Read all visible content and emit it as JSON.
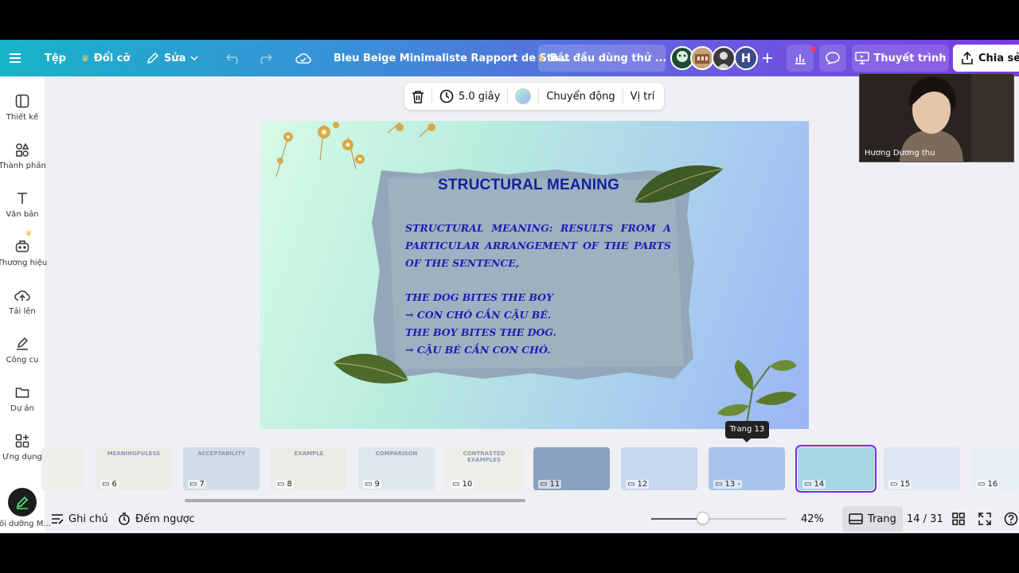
{
  "colors": {
    "accent": "#7d2ae8",
    "slide_text": "#1c1cb4",
    "slide_heading": "#12229a"
  },
  "topbar": {
    "menu_icon": "hamburger-icon",
    "file_label": "Tệp",
    "resize_label": "Đổi cỡ",
    "edit_label": "Sửa",
    "document_title": "Bleu Beige Minimaliste Rapport de Sta...",
    "trial_label": "Bắt đầu dùng thử ...",
    "avatar_initial": "H",
    "present_label": "Thuyết trình",
    "share_label": "Chia sẻ"
  },
  "sidebar": {
    "items": [
      {
        "label": "Thiết kế",
        "icon": "layout-icon"
      },
      {
        "label": "Thành phần",
        "icon": "elements-icon"
      },
      {
        "label": "Văn bản",
        "icon": "text-icon"
      },
      {
        "label": "Thương hiệu",
        "icon": "brand-icon"
      },
      {
        "label": "Tải lên",
        "icon": "upload-icon"
      },
      {
        "label": "Công cụ",
        "icon": "draw-icon"
      },
      {
        "label": "Dự án",
        "icon": "folder-icon"
      },
      {
        "label": "Ứng dụng",
        "icon": "apps-icon"
      },
      {
        "label": "Bối dưỡng M..."
      }
    ]
  },
  "context_toolbar": {
    "duration": "5.0 giây",
    "animation": "Chuyển động",
    "position": "Vị trí"
  },
  "slide": {
    "heading": "STRUCTURAL MEANING",
    "definition": "STRUCTURAL MEANING: RESULTS FROM A PARTICULAR ARRANGEMENT OF THE PARTS OF THE SENTENCE,",
    "examples": [
      "THE DOG BITES THE BOY",
      "→ CON CHÓ CẮN CẬU BÉ.",
      "THE BOY BITES THE DOG.",
      "→ CẬU BÉ CẮN CON CHÓ."
    ]
  },
  "webcam": {
    "name": "Hương Dương thu"
  },
  "filmstrip": {
    "tooltip": "Trang 13",
    "pages": [
      {
        "num": "6",
        "title": "MEANINGFULESS",
        "bg": "#ecece7"
      },
      {
        "num": "7",
        "title": "ACCEPTABILITY",
        "bg": "#cfdde6"
      },
      {
        "num": "8",
        "title": "EXAMPLE",
        "bg": "#ecebe6"
      },
      {
        "num": "9",
        "title": "COMPARISON",
        "bg": "#dfe6ee"
      },
      {
        "num": "10",
        "title": "CONTRASTED EXAMPLES",
        "bg": "#eeede8"
      },
      {
        "num": "11",
        "title": "",
        "bg": "#8aa0c0"
      },
      {
        "num": "12",
        "title": "",
        "bg": "#c9d6f0"
      },
      {
        "num": "13 -",
        "title": "",
        "bg": "#a8c4ec"
      },
      {
        "num": "14",
        "title": "",
        "bg": "#a6d6e6"
      },
      {
        "num": "15",
        "title": "",
        "bg": "#dde6f3"
      },
      {
        "num": "16",
        "title": "",
        "bg": "#e6eef6"
      }
    ]
  },
  "bottom": {
    "notes_label": "Ghi chú",
    "timer_label": "Đếm ngược",
    "zoom_value": "42%",
    "zoom_fraction": 0.38,
    "page_view_label": "Trang",
    "page_counter": "14 / 31"
  }
}
